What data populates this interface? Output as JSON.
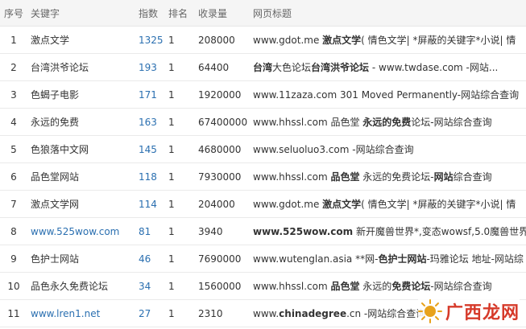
{
  "headers": {
    "seq": "序号",
    "keyword": "关键字",
    "index": "指数",
    "rank": "排名",
    "count": "收录量",
    "title": "网页标题"
  },
  "rows": [
    {
      "seq": "1",
      "keyword": "激点文学",
      "index": "1325",
      "rank": "1",
      "count": "208000",
      "title_parts": [
        [
          "www.gdot.me ",
          false
        ],
        [
          "激点文学",
          true
        ],
        [
          "( 情色文学| *屏蔽的关键字*小说| 情",
          false
        ]
      ]
    },
    {
      "seq": "2",
      "keyword": "台湾洪爷论坛",
      "index": "193",
      "rank": "1",
      "count": "64400",
      "title_parts": [
        [
          "台湾",
          true
        ],
        [
          "大色论坛",
          false
        ],
        [
          "台湾洪爷论坛",
          true
        ],
        [
          " - www.twdase.com -网站...",
          false
        ]
      ]
    },
    {
      "seq": "3",
      "keyword": "色蝎子电影",
      "index": "171",
      "rank": "1",
      "count": "1920000",
      "title_parts": [
        [
          "www.11zaza.com 301 Moved Permanently-网站综合查询",
          false
        ]
      ]
    },
    {
      "seq": "4",
      "keyword": "永远的免费",
      "index": "163",
      "rank": "1",
      "count": "67400000",
      "title_parts": [
        [
          "www.hhssl.com 品色堂 ",
          false
        ],
        [
          "永远的免费",
          true
        ],
        [
          "论坛-网站综合查询",
          false
        ]
      ]
    },
    {
      "seq": "5",
      "keyword": "色狼落中文网",
      "index": "145",
      "rank": "1",
      "count": "4680000",
      "title_parts": [
        [
          "www.seluoluo3.com -网站综合查询",
          false
        ]
      ]
    },
    {
      "seq": "6",
      "keyword": "品色堂网站",
      "index": "118",
      "rank": "1",
      "count": "7930000",
      "title_parts": [
        [
          "www.hhssl.com ",
          false
        ],
        [
          "品色堂",
          true
        ],
        [
          " 永远的免费论坛-",
          false
        ],
        [
          "网站",
          true
        ],
        [
          "综合查询",
          false
        ]
      ]
    },
    {
      "seq": "7",
      "keyword": "激点文学网",
      "index": "114",
      "rank": "1",
      "count": "204000",
      "title_parts": [
        [
          "www.gdot.me ",
          false
        ],
        [
          "激点文学",
          true
        ],
        [
          "( 情色文学| *屏蔽的关键字*小说| 情",
          false
        ]
      ]
    },
    {
      "seq": "8",
      "keyword": "www.525wow.com",
      "keyword_link": true,
      "index": "81",
      "rank": "1",
      "count": "3940",
      "title_parts": [
        [
          "www.525wow.com",
          true
        ],
        [
          " 新开魔兽世界*,变态wowsf,5.0魔兽世界",
          false
        ]
      ]
    },
    {
      "seq": "9",
      "keyword": "色护士网站",
      "index": "46",
      "rank": "1",
      "count": "7690000",
      "title_parts": [
        [
          "www.wutenglan.asia **网-",
          false
        ],
        [
          "色护士网站",
          true
        ],
        [
          "-玛雅论坛 地址-网站综",
          false
        ]
      ]
    },
    {
      "seq": "10",
      "keyword": "品色永久免费论坛",
      "index": "34",
      "rank": "1",
      "count": "1560000",
      "title_parts": [
        [
          "www.hhssl.com ",
          false
        ],
        [
          "品色堂",
          true
        ],
        [
          " 永远的",
          false
        ],
        [
          "免费论坛",
          true
        ],
        [
          "-网站综合查询",
          false
        ]
      ]
    },
    {
      "seq": "11",
      "keyword": "www.lren1.net",
      "keyword_link": true,
      "index": "27",
      "rank": "1",
      "count": "2310",
      "title_parts": [
        [
          "www.",
          false
        ],
        [
          "chinadegree",
          true
        ],
        [
          ".cn -网站综合查询",
          false
        ]
      ]
    }
  ],
  "watermark": {
    "text": "广西龙网",
    "icon": "sun-logo-icon"
  },
  "colors": {
    "link": "#2a6fb0",
    "header_bg": "#f5f5f5",
    "watermark": "#d63a2a"
  }
}
